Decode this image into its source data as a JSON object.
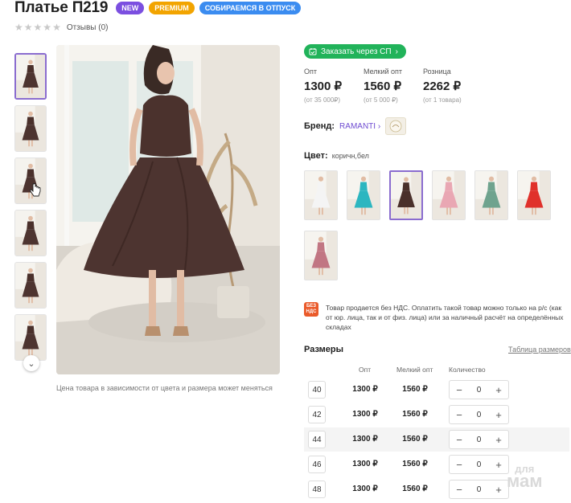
{
  "product": {
    "title": "Платье П219",
    "badges": [
      {
        "label": "NEW",
        "color": "#7b4fe0"
      },
      {
        "label": "PREMIUM",
        "color": "#f2a400"
      },
      {
        "label": "СОБИРАЕМСЯ В ОТПУСК",
        "color": "#3b8cf0"
      }
    ],
    "rating_stars": 0,
    "reviews": "Отзывы (0)",
    "photo_note": "Цена товара в зависимости от цвета и размера может меняться"
  },
  "order": {
    "label": "Заказать через СП",
    "icon": "calendar-check-icon",
    "color": "#21b35a"
  },
  "prices": [
    {
      "label": "Опт",
      "value": "1300 ₽",
      "min": "(от 35 000₽)"
    },
    {
      "label": "Мелкий опт",
      "value": "1560 ₽",
      "min": "(от 5 000 ₽)"
    },
    {
      "label": "Розница",
      "value": "2262 ₽",
      "min": "(от 1 товара)"
    }
  ],
  "brand": {
    "label": "Бренд:",
    "name": "RAMANTI",
    "chevron": "›"
  },
  "color": {
    "label": "Цвет:",
    "value": "коричн,бел"
  },
  "swatches": [
    {
      "name": "white",
      "dress": "#f4f4f4"
    },
    {
      "name": "turquoise",
      "dress": "#2cb6c0"
    },
    {
      "name": "brown",
      "dress": "#4a302b",
      "active": true
    },
    {
      "name": "pink",
      "dress": "#e9a7b3"
    },
    {
      "name": "sage",
      "dress": "#6fa38e"
    },
    {
      "name": "red",
      "dress": "#e0312b"
    },
    {
      "name": "mauve-print",
      "dress": "#c17683"
    }
  ],
  "vat": {
    "icon": "БЕЗ НДС",
    "text": "Товар продается без НДС. Оплатить такой товар можно только на р/с (как от юр. лица, так и от физ. лица) или за наличный расчёт на определённых складах"
  },
  "sizes": {
    "title": "Размеры",
    "table_link": "Таблица размеров",
    "headers": {
      "opt": "Опт",
      "small": "Мелкий опт",
      "qty": "Количество"
    },
    "rows": [
      {
        "size": "40",
        "opt": "1300 ₽",
        "small": "1560 ₽",
        "qty": "0",
        "minus": "−",
        "plus": "+"
      },
      {
        "size": "42",
        "opt": "1300 ₽",
        "small": "1560 ₽",
        "qty": "0",
        "minus": "−",
        "plus": "+"
      },
      {
        "size": "44",
        "opt": "1300 ₽",
        "small": "1560 ₽",
        "qty": "0",
        "minus": "−",
        "plus": "+"
      },
      {
        "size": "46",
        "opt": "1300 ₽",
        "small": "1560 ₽",
        "qty": "0",
        "minus": "−",
        "plus": "+"
      },
      {
        "size": "48",
        "opt": "1300 ₽",
        "small": "1560 ₽",
        "qty": "0",
        "minus": "−",
        "plus": "+"
      }
    ]
  },
  "watermark": {
    "top": "для",
    "bottom": "мам"
  },
  "thumbs_arrow": "chevron-down-icon"
}
